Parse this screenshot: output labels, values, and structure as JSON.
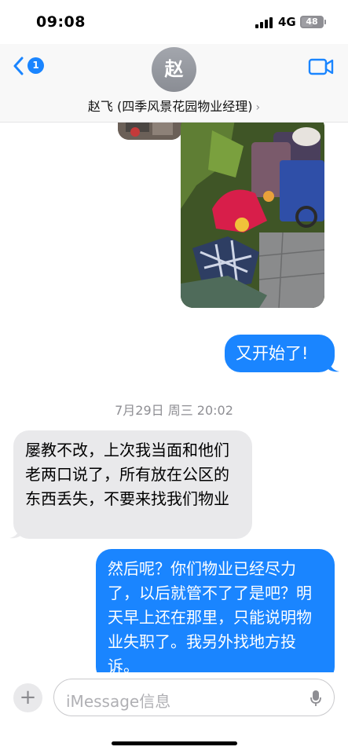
{
  "status": {
    "time": "09:08",
    "network": "4G",
    "battery": "48"
  },
  "header": {
    "back_badge": "1",
    "avatar_initial": "赵",
    "contact_name": "赵飞 (四季风景花园物业经理)",
    "chevron": "›"
  },
  "messages": [
    {
      "sender": "me",
      "text": "又开始了!"
    },
    {
      "sender": "system",
      "text": "7月29日 周三 20:02"
    },
    {
      "sender": "them",
      "text": "屡教不改，上次我当面和他们老两口说了，所有放在公区的东西丢失，不要来找我们物业"
    },
    {
      "sender": "me",
      "text": "然后呢？你们物业已经尽力了，以后就管不了了是吧？明天早上还在那里，只能说明物业失职了。我另外找地方投诉。"
    }
  ],
  "input": {
    "plus": "+",
    "placeholder": "iMessage信息"
  },
  "colors": {
    "accent": "#1a85ff",
    "incoming_bubble": "#e9e9eb"
  }
}
